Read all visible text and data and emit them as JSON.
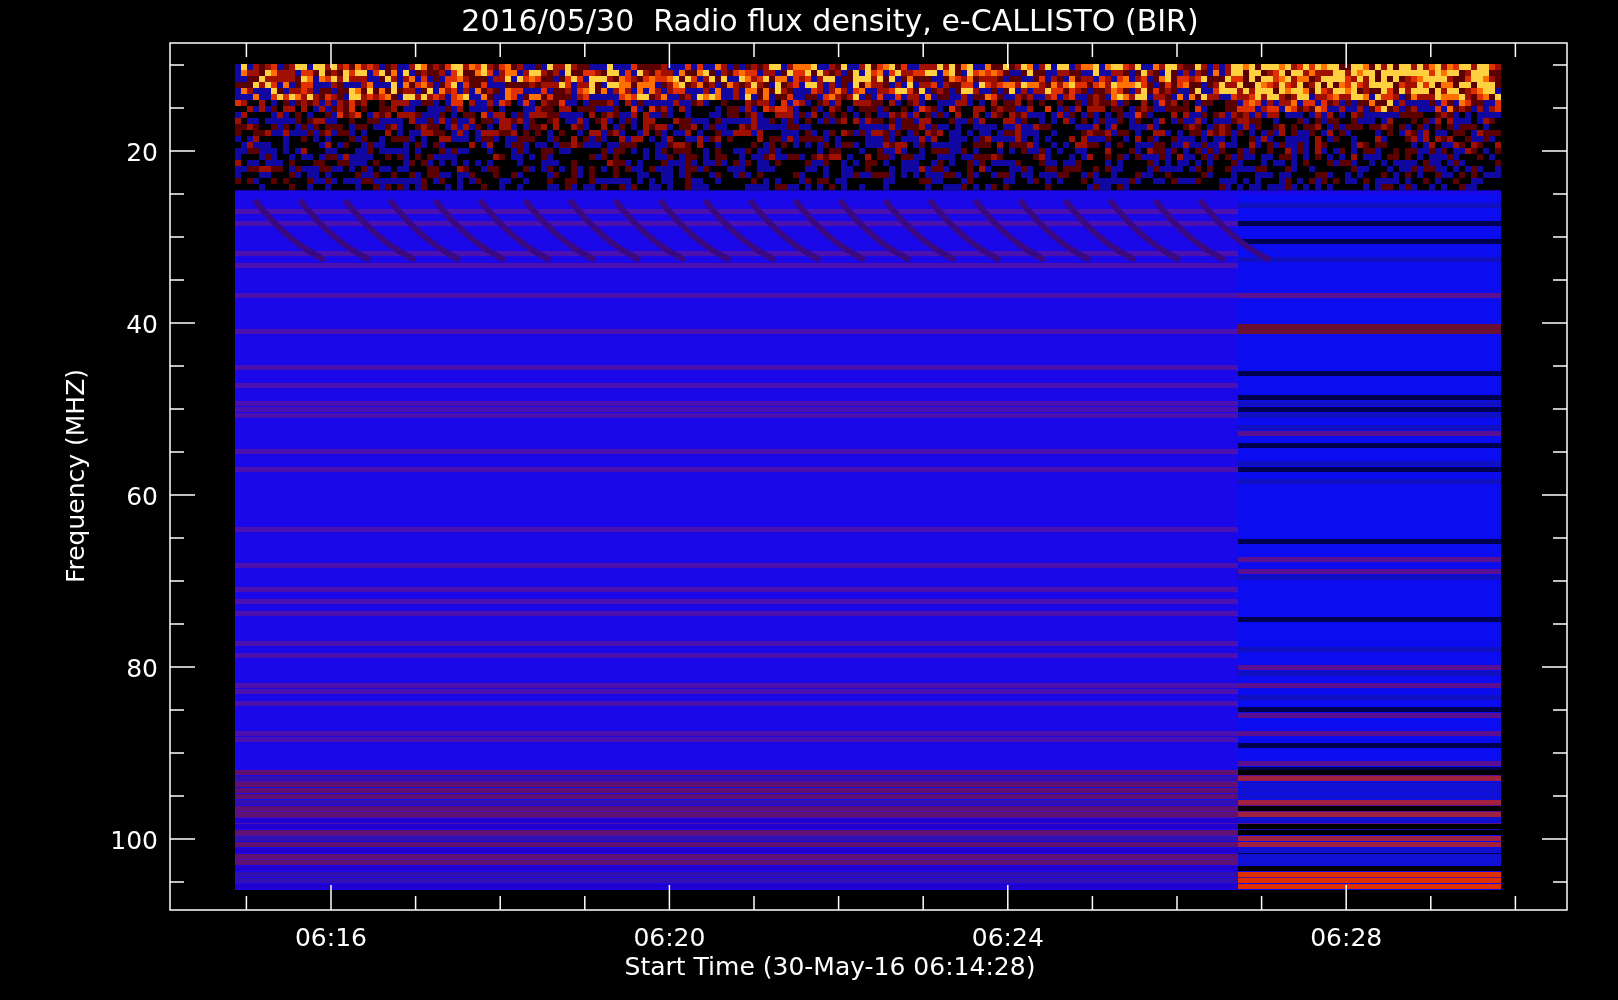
{
  "title": "2016/05/30  Radio flux density, e-CALLISTO (BIR)",
  "ylabel": "Frequency (MHZ)",
  "xlabel": "Start Time (30-May-16 06:14:28)",
  "yticks": [
    "20",
    "40",
    "60",
    "80",
    "100"
  ],
  "xticks": [
    "06:16",
    "06:20",
    "06:24",
    "06:28"
  ]
}
